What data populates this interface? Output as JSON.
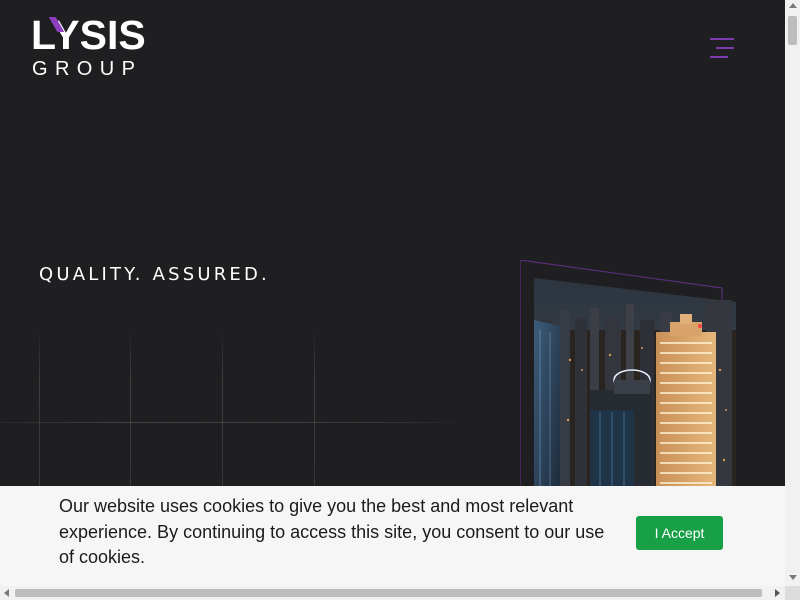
{
  "header": {
    "logo_top": "LYSIS",
    "logo_bottom": "GROUP",
    "menu_icon": "hamburger-menu-icon"
  },
  "hero": {
    "tagline": "QUALITY. ASSURED.",
    "image_icon": "city-skyline-image"
  },
  "cookie_banner": {
    "message": "Our website uses cookies to give you the best and most relevant experience. By continuing to access this site, you consent to our use of cookies.",
    "accept_label": "I Accept"
  },
  "colors": {
    "background": "#1f1e20",
    "brand_accent": "#8e3fbf",
    "accept_button": "#18a047",
    "banner_background": "#f6f6f6"
  }
}
